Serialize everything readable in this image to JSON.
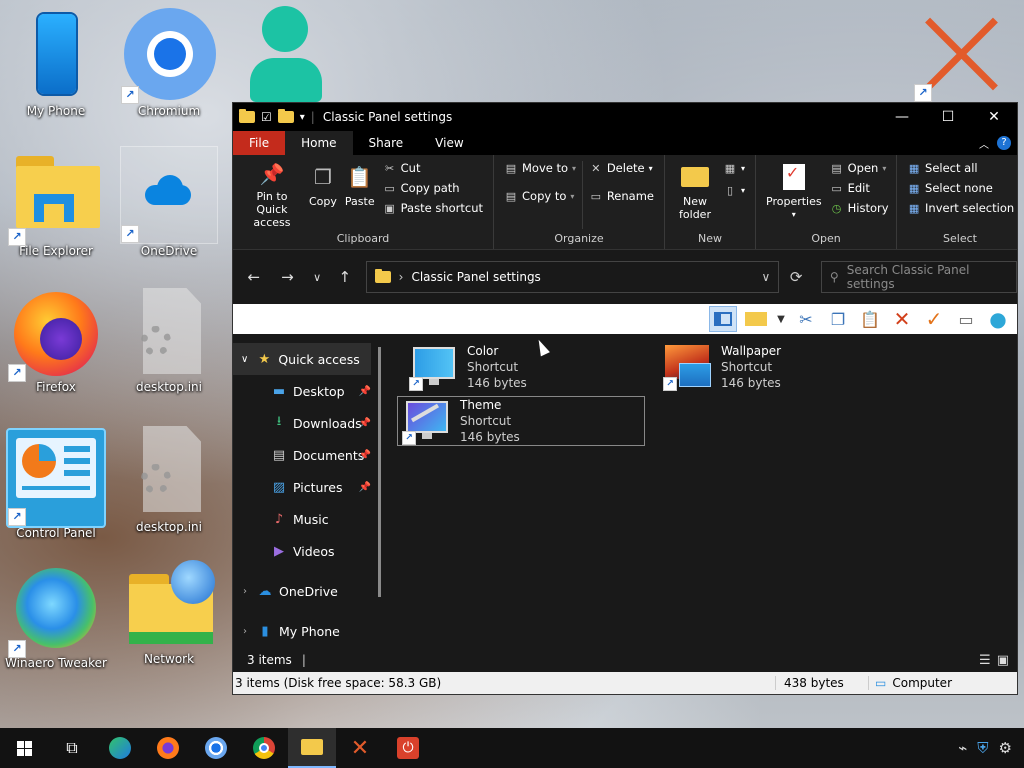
{
  "desktop": {
    "icons": [
      {
        "label": "My Phone",
        "icon": "phone-icon"
      },
      {
        "label": "Chromium",
        "icon": "chromium-icon"
      },
      {
        "label": "File Explorer",
        "icon": "file-explorer-icon"
      },
      {
        "label": "OneDrive",
        "icon": "onedrive-icon"
      },
      {
        "label": "Firefox",
        "icon": "firefox-icon"
      },
      {
        "label": "desktop.ini",
        "icon": "settings-file-icon"
      },
      {
        "label": "Control Panel",
        "icon": "control-panel-icon"
      },
      {
        "label": "desktop.ini",
        "icon": "settings-file-icon"
      },
      {
        "label": "Winaero Tweaker",
        "icon": "winaero-icon"
      },
      {
        "label": "Network",
        "icon": "network-icon"
      }
    ]
  },
  "explorer": {
    "title": "Classic Panel settings",
    "window_buttons": {
      "minimize": "—",
      "maximize": "☐",
      "close": "✕"
    },
    "tabs": {
      "file": "File",
      "home": "Home",
      "share": "Share",
      "view": "View"
    },
    "ribbon": {
      "clipboard": {
        "name": "Clipboard",
        "pin_label": "Pin to Quick access",
        "copy_label": "Copy",
        "paste_label": "Paste",
        "cut_label": "Cut",
        "copy_path_label": "Copy path",
        "paste_shortcut_label": "Paste shortcut"
      },
      "organize": {
        "name": "Organize",
        "move_to_label": "Move to",
        "copy_to_label": "Copy to",
        "delete_label": "Delete",
        "rename_label": "Rename"
      },
      "new": {
        "name": "New",
        "new_folder_label": "New folder"
      },
      "open": {
        "name": "Open",
        "properties_label": "Properties",
        "open_label": "Open",
        "edit_label": "Edit",
        "history_label": "History"
      },
      "select": {
        "name": "Select",
        "select_all_label": "Select all",
        "select_none_label": "Select none",
        "invert_label": "Invert selection"
      }
    },
    "address": {
      "path": "Classic Panel settings",
      "search_placeholder": "Search Classic Panel settings"
    },
    "nav_pane": {
      "quick_access": "Quick access",
      "items": [
        {
          "label": "Desktop",
          "pinned": true
        },
        {
          "label": "Downloads",
          "pinned": true
        },
        {
          "label": "Documents",
          "pinned": true
        },
        {
          "label": "Pictures",
          "pinned": true
        },
        {
          "label": "Music",
          "pinned": false
        },
        {
          "label": "Videos",
          "pinned": false
        }
      ],
      "onedrive": "OneDrive",
      "my_phone": "My Phone"
    },
    "files": [
      {
        "name": "Color",
        "type": "Shortcut",
        "size": "146 bytes"
      },
      {
        "name": "Wallpaper",
        "type": "Shortcut",
        "size": "146 bytes"
      },
      {
        "name": "Theme",
        "type": "Shortcut",
        "size": "146 bytes"
      }
    ],
    "items_count": "3 items",
    "status": {
      "left": "3 items (Disk free space: 58.3 GB)",
      "size": "438 bytes",
      "location": "Computer"
    }
  },
  "colors": {
    "file_tab": "#c42b1c",
    "accent": "#1e73d4",
    "folder": "#f3c94b"
  }
}
